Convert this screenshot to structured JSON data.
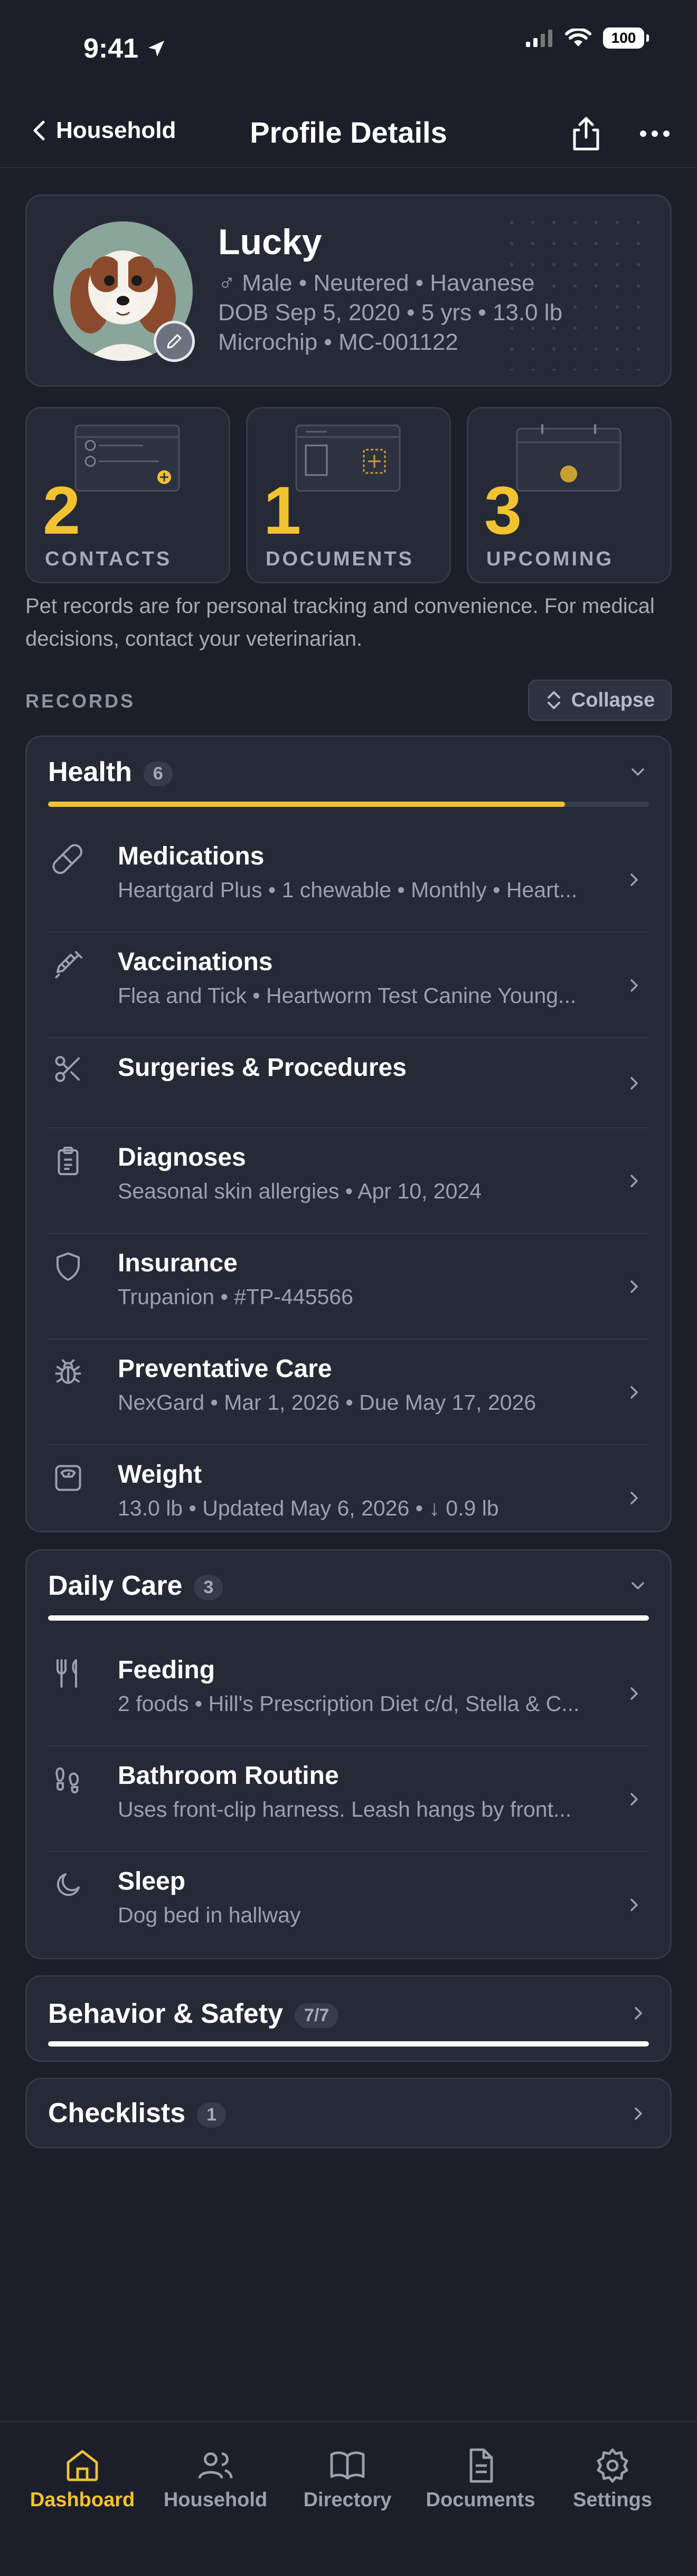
{
  "status_bar": {
    "time": "9:41",
    "battery": "100"
  },
  "nav": {
    "back_label": "Household",
    "title": "Profile Details"
  },
  "profile": {
    "name": "Lucky",
    "details_line": "♂ Male • Neutered • Havanese",
    "dob_line": "DOB Sep 5, 2020 • 5 yrs • 13.0 lb",
    "microchip_line": "Microchip • MC-001122"
  },
  "stats": [
    {
      "value": "2",
      "label": "CONTACTS"
    },
    {
      "value": "1",
      "label": "DOCUMENTS"
    },
    {
      "value": "3",
      "label": "UPCOMING"
    }
  ],
  "disclaimer": "Pet records are for personal tracking and convenience. For medical decisions, contact your veterinarian.",
  "records": {
    "label": "RECORDS",
    "collapse_label": "Collapse"
  },
  "groups": {
    "health": {
      "title": "Health",
      "count": "6",
      "progress": 0.86,
      "items": [
        {
          "icon": "pill-icon",
          "title": "Medications",
          "subtitle": "Heartgard Plus • 1 chewable • Monthly • Heart..."
        },
        {
          "icon": "syringe-icon",
          "title": "Vaccinations",
          "subtitle": "Flea and Tick • Heartworm Test Canine Young..."
        },
        {
          "icon": "scissors-icon",
          "title": "Surgeries & Procedures",
          "subtitle": ""
        },
        {
          "icon": "clipboard-icon",
          "title": "Diagnoses",
          "subtitle": "Seasonal skin allergies • Apr 10, 2024"
        },
        {
          "icon": "shield-icon",
          "title": "Insurance",
          "subtitle": "Trupanion • #TP-445566"
        },
        {
          "icon": "bug-icon",
          "title": "Preventative Care",
          "subtitle": "NexGard • Mar 1, 2026 • Due May 17, 2026"
        },
        {
          "icon": "scale-icon",
          "title": "Weight",
          "subtitle": "13.0 lb • Updated May 6, 2026 • ↓ 0.9 lb"
        }
      ]
    },
    "daily_care": {
      "title": "Daily Care",
      "count": "3",
      "progress": 1.0,
      "items": [
        {
          "icon": "utensils-icon",
          "title": "Feeding",
          "subtitle": "2 foods • Hill's Prescription Diet c/d, Stella & C..."
        },
        {
          "icon": "footprints-icon",
          "title": "Bathroom Routine",
          "subtitle": "Uses front-clip harness. Leash hangs by front..."
        },
        {
          "icon": "moon-icon",
          "title": "Sleep",
          "subtitle": "Dog bed in hallway"
        }
      ]
    },
    "behavior": {
      "title": "Behavior & Safety",
      "count": "7/7",
      "progress": 1.0
    },
    "checklists": {
      "title": "Checklists",
      "count": "1"
    }
  },
  "tabs": [
    {
      "label": "Dashboard",
      "icon": "home-icon",
      "active": true
    },
    {
      "label": "Household",
      "icon": "users-icon",
      "active": false
    },
    {
      "label": "Directory",
      "icon": "book-icon",
      "active": false
    },
    {
      "label": "Documents",
      "icon": "file-icon",
      "active": false
    },
    {
      "label": "Settings",
      "icon": "gear-icon",
      "active": false
    }
  ],
  "colors": {
    "accent": "#f2c230",
    "background": "#1c1f2a",
    "card": "#262a37"
  }
}
